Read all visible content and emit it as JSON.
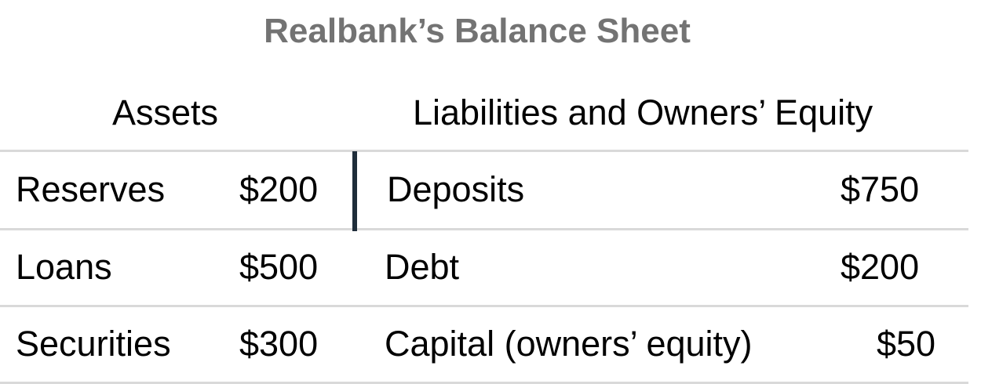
{
  "title": "Realbank’s Balance Sheet",
  "headers": {
    "assets": "Assets",
    "liabilities": "Liabilities and Owners’ Equity"
  },
  "rows": [
    {
      "asset_label": "Reserves",
      "asset_value": "$200",
      "liability_label": "Deposits",
      "liability_value": "$750"
    },
    {
      "asset_label": "Loans",
      "asset_value": "$500",
      "liability_label": "Debt",
      "liability_value": "$200"
    },
    {
      "asset_label": "Securities",
      "asset_value": "$300",
      "liability_label": "Capital (owners’ equity)",
      "liability_value": "$50"
    }
  ]
}
